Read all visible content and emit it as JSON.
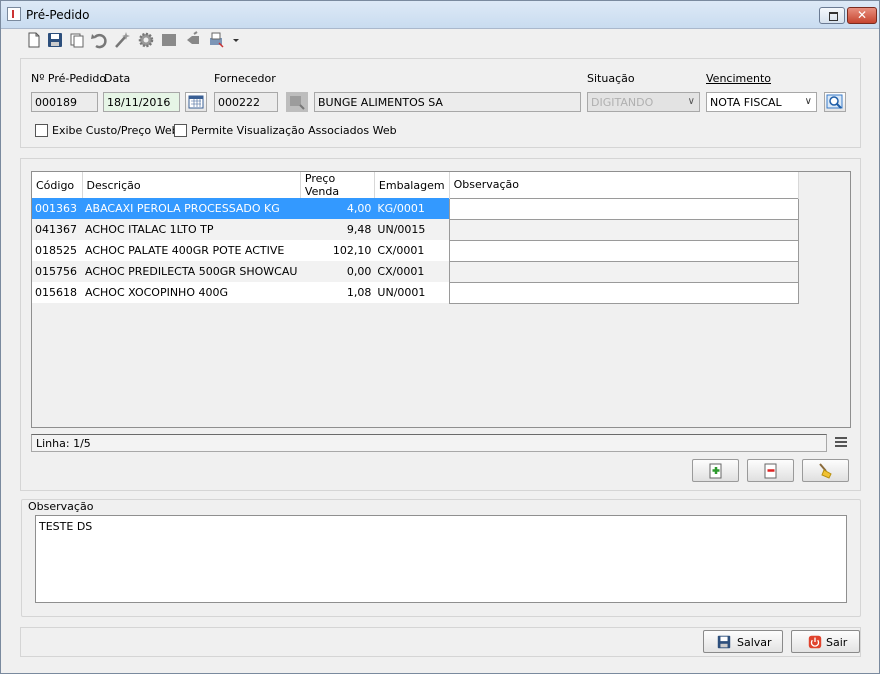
{
  "window": {
    "title": "Pré-Pedido",
    "close_glyph": "✕"
  },
  "toolbar": {
    "icons": [
      "new-doc-icon",
      "save-icon",
      "copy-icon",
      "undo-icon",
      "wand-icon",
      "gear-icon",
      "stop-icon",
      "delete-icon",
      "print-icon"
    ]
  },
  "header": {
    "numero_label": "Nº Pré-Pedido",
    "numero_value": "000189",
    "data_label": "Data",
    "data_value": "18/11/2016",
    "fornecedor_label": "Fornecedor",
    "fornecedor_code": "000222",
    "fornecedor_name": "BUNGE ALIMENTOS SA",
    "situacao_label": "Situação",
    "situacao_value": "DIGITANDO",
    "vencimento_label": "Vencimento",
    "vencimento_value": "NOTA FISCAL",
    "chk_custo_label": "Exibe Custo/Preço Web",
    "chk_visualizacao_label": "Permite Visualização Associados Web"
  },
  "grid": {
    "columns": [
      "Código",
      "Descrição",
      "Preço Venda",
      "Embalagem",
      "Observação"
    ],
    "rows": [
      {
        "codigo": "001363",
        "descricao": "ABACAXI PEROLA PROCESSADO KG",
        "preco": "4,00",
        "embalagem": "KG/0001",
        "obs": ""
      },
      {
        "codigo": "041367",
        "descricao": "ACHOC ITALAC 1LTO TP",
        "preco": "9,48",
        "embalagem": "UN/0015",
        "obs": ""
      },
      {
        "codigo": "018525",
        "descricao": "ACHOC PALATE 400GR POTE ACTIVE",
        "preco": "102,10",
        "embalagem": "CX/0001",
        "obs": ""
      },
      {
        "codigo": "015756",
        "descricao": "ACHOC PREDILECTA 500GR SHOWCAU",
        "preco": "0,00",
        "embalagem": "CX/0001",
        "obs": ""
      },
      {
        "codigo": "015618",
        "descricao": "ACHOC XOCOPINHO 400G",
        "preco": "1,08",
        "embalagem": "UN/0001",
        "obs": ""
      }
    ],
    "status": "Linha: 1/5"
  },
  "observacao": {
    "label": "Observação",
    "value": "TESTE DS"
  },
  "footer": {
    "salvar_label": "Salvar",
    "sair_label": "Sair"
  },
  "colors": {
    "selection": "#3399ff",
    "title_bar": "#c9dcf0"
  }
}
